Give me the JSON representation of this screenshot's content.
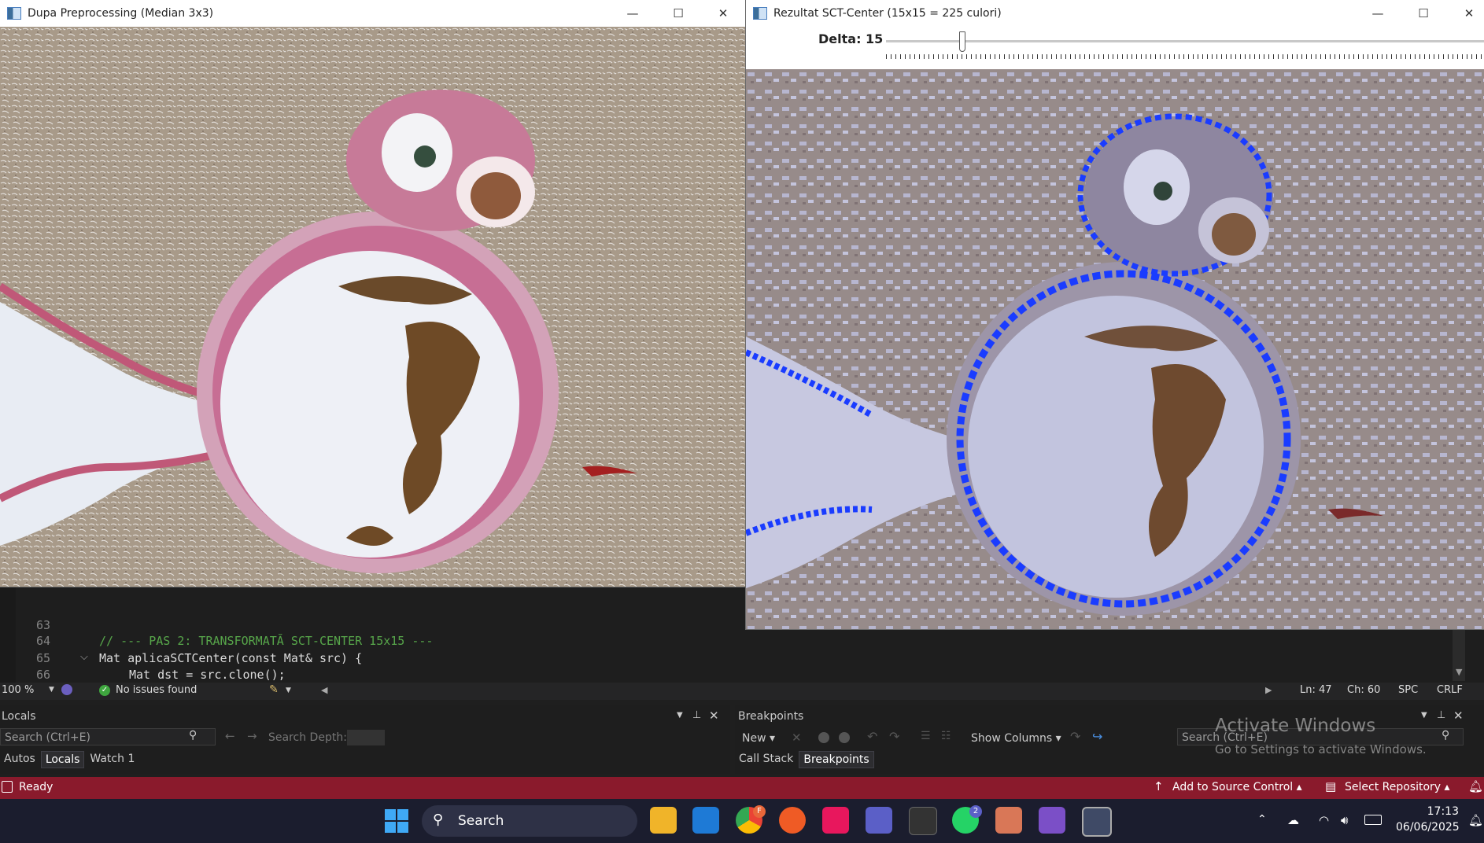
{
  "left_window": {
    "title": "Dupa Preprocessing (Median 3x3)",
    "controls": [
      "—",
      "☐",
      "✕"
    ]
  },
  "right_window": {
    "title": "Rezultat SCT-Center (15x15 = 225 culori)",
    "controls": [
      "—",
      "☐",
      "✕"
    ],
    "slider": {
      "label": "Delta: 15",
      "value": 15
    }
  },
  "editor": {
    "lines": [
      {
        "num": "63",
        "text": ""
      },
      {
        "num": "64",
        "text": "// --- PAS 2: TRANSFORMATĂ SCT-CENTER 15x15 ---"
      },
      {
        "num": "65",
        "text": "Mat aplicaSCTCenter(const Mat& src) {"
      },
      {
        "num": "66",
        "text": "Mat dst = src.clone();"
      }
    ],
    "zoom": "100 %",
    "issues": "No issues found",
    "position": {
      "ln": "Ln: 47",
      "ch": "Ch: 60",
      "spc": "SPC",
      "eol": "CRLF"
    }
  },
  "locals_panel": {
    "title": "Locals",
    "search_placeholder": "Search (Ctrl+E)",
    "depth_label": "Search Depth:",
    "tabs": [
      "Autos",
      "Locals",
      "Watch 1"
    ],
    "active_tab": "Locals"
  },
  "breakpoints_panel": {
    "title": "Breakpoints",
    "new_label": "New",
    "show_columns": "Show Columns",
    "search_placeholder": "Search (Ctrl+E)",
    "tabs": [
      "Call Stack",
      "Breakpoints"
    ],
    "active_tab": "Breakpoints"
  },
  "watermark": {
    "line1": "Activate Windows",
    "line2": "Go to Settings to activate Windows."
  },
  "statusbar": {
    "ready": "Ready",
    "source_control": "Add to Source Control",
    "repository": "Select Repository",
    "color": "#8a1a2c"
  },
  "taskbar": {
    "search_label": "Search",
    "time": "17:13",
    "date": "06/06/2025",
    "badge_chrome": "F",
    "badge_whatsapp": "2"
  }
}
